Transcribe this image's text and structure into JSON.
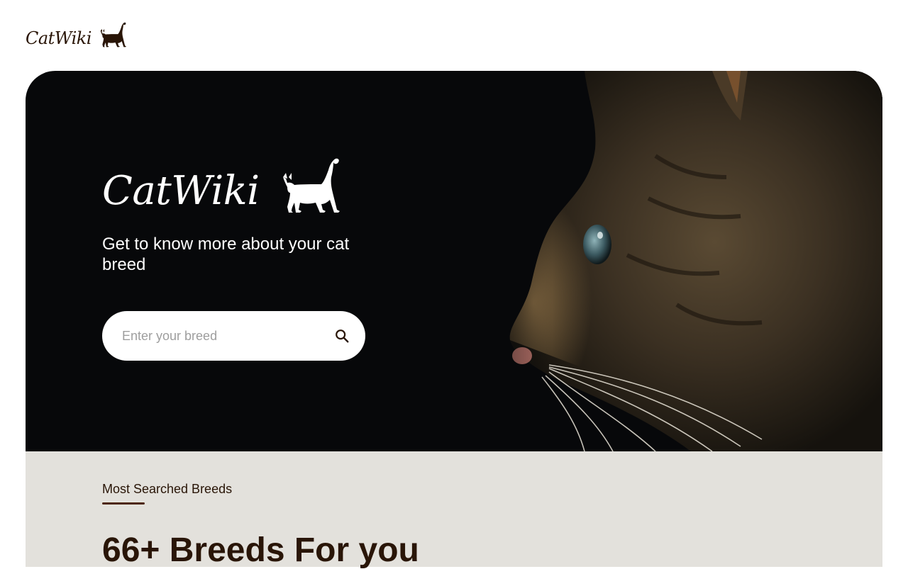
{
  "header": {
    "logo_text": "CatWiki"
  },
  "hero": {
    "logo_text": "CatWiki",
    "tagline": "Get to know more about your cat breed",
    "search": {
      "placeholder": "Enter your breed",
      "value": ""
    }
  },
  "breeds_section": {
    "label": "Most Searched Breeds",
    "heading": "66+ Breeds For you"
  },
  "icons": {
    "logo_cat": "cat-silhouette-icon",
    "search": "search-icon"
  },
  "colors": {
    "brand_dark": "#291507",
    "hero_bg": "#07080a",
    "section_bg": "#e3e1dc",
    "accent_underline": "#4d270c"
  }
}
